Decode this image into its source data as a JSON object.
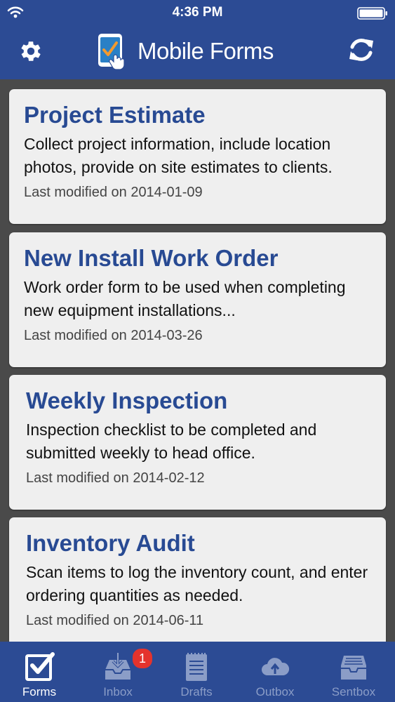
{
  "status_bar": {
    "time": "4:36 PM"
  },
  "header": {
    "title": "Mobile Forms"
  },
  "forms": [
    {
      "title": "Project Estimate",
      "description": "Collect project information, include location photos, provide on site estimates to clients.",
      "modified": "Last modified on 2014-01-09"
    },
    {
      "title": "New Install Work Order",
      "description": "Work order form to be used when completing new equipment installations...",
      "modified": "Last modified on 2014-03-26"
    },
    {
      "title": "Weekly Inspection",
      "description": "Inspection checklist to be completed and submitted weekly to head office.",
      "modified": "Last modified on 2014-02-12"
    },
    {
      "title": "Inventory Audit",
      "description": "Scan items to log the inventory count, and enter ordering quantities as needed.",
      "modified": "Last modified on 2014-06-11"
    }
  ],
  "tabs": [
    {
      "label": "Forms",
      "icon": "checkbox-icon",
      "active": true
    },
    {
      "label": "Inbox",
      "icon": "inbox-icon",
      "badge": "1"
    },
    {
      "label": "Drafts",
      "icon": "notepad-icon"
    },
    {
      "label": "Outbox",
      "icon": "cloud-upload-icon"
    },
    {
      "label": "Sentbox",
      "icon": "tray-icon"
    }
  ],
  "colors": {
    "header_bg": "#2c4b94",
    "card_title": "#284a93",
    "badge": "#e4332d",
    "inactive_tab": "#8b9dc7"
  }
}
